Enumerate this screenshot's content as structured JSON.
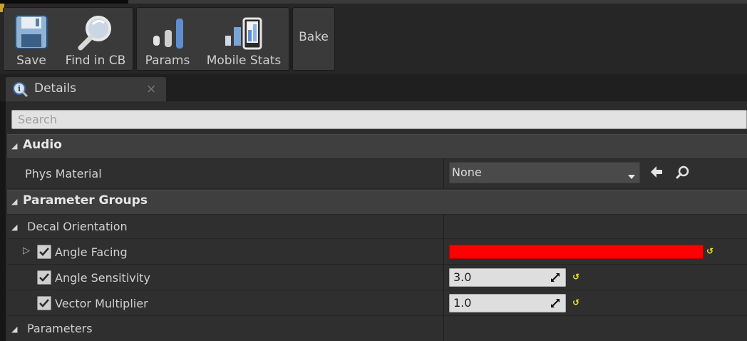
{
  "toolbar": {
    "save_label": "Save",
    "find_label": "Find in CB",
    "params_label": "Params",
    "mobile_label": "Mobile Stats",
    "bake_label": "Bake"
  },
  "tab": {
    "label": "Details",
    "close": "×"
  },
  "search": {
    "placeholder": "Search",
    "value": ""
  },
  "audio": {
    "header": "Audio",
    "phys_material_label": "Phys Material",
    "phys_material_value": "None"
  },
  "parameter_groups": {
    "header": "Parameter Groups",
    "decal_orientation": "Decal Orientation",
    "angle_facing": {
      "label": "Angle Facing",
      "checked": true,
      "color": "#ff0000"
    },
    "angle_sensitivity": {
      "label": "Angle Sensitivity",
      "checked": true,
      "value": "3.0"
    },
    "vector_multiplier": {
      "label": "Vector Multiplier",
      "checked": true,
      "value": "1.0"
    },
    "parameters": "Parameters"
  },
  "icons": {
    "reset": "↺",
    "expand": "▷",
    "collapse": "◢"
  },
  "colors": {
    "accent_reset": "#f4e21c",
    "color_param": "#ff0000"
  }
}
